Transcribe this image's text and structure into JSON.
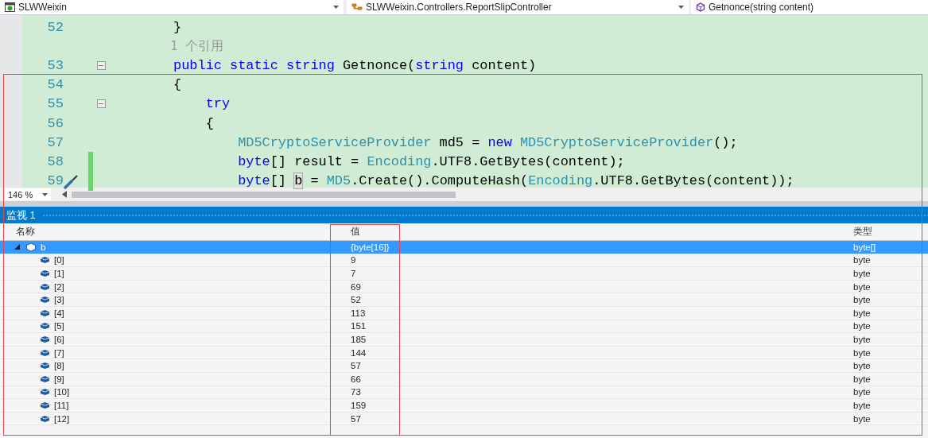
{
  "toolbar": {
    "project": "SLWWeixin",
    "class": "SLWWeixin.Controllers.ReportSlipController",
    "member": "Getnonce(string content)"
  },
  "editor": {
    "lines": [
      {
        "number": "52",
        "collapsible": false,
        "changed": false,
        "quick_action": false,
        "tokens": [
          {
            "text": "        }",
            "kind": "plain"
          }
        ]
      },
      {
        "collapsible": false,
        "changed": false,
        "quick_action": false,
        "tokens": [
          {
            "text": "        1 个引用",
            "kind": "hint"
          }
        ]
      },
      {
        "number": "53",
        "collapsible": true,
        "changed": false,
        "quick_action": false,
        "tokens": [
          {
            "text": "        public static string",
            "kind": "keyword"
          },
          {
            "text": " Getnonce(",
            "kind": "plain"
          },
          {
            "text": "string",
            "kind": "keyword"
          },
          {
            "text": " content)",
            "kind": "plain"
          }
        ]
      },
      {
        "number": "54",
        "collapsible": false,
        "changed": false,
        "quick_action": false,
        "tokens": [
          {
            "text": "        {",
            "kind": "plain"
          }
        ]
      },
      {
        "number": "55",
        "collapsible": true,
        "changed": false,
        "quick_action": false,
        "tokens": [
          {
            "text": "            try",
            "kind": "keyword"
          }
        ]
      },
      {
        "number": "56",
        "collapsible": false,
        "changed": false,
        "quick_action": false,
        "tokens": [
          {
            "text": "            {",
            "kind": "plain"
          }
        ]
      },
      {
        "number": "57",
        "collapsible": false,
        "changed": false,
        "quick_action": false,
        "tokens": [
          {
            "text": "                MD5CryptoServiceProvider",
            "kind": "type"
          },
          {
            "text": " md5 = ",
            "kind": "plain"
          },
          {
            "text": "new",
            "kind": "keyword"
          },
          {
            "text": " MD5CryptoServiceProvider",
            "kind": "type"
          },
          {
            "text": "();",
            "kind": "plain"
          }
        ]
      },
      {
        "number": "58",
        "collapsible": false,
        "changed": true,
        "quick_action": false,
        "tokens": [
          {
            "text": "                byte",
            "kind": "keyword"
          },
          {
            "text": "[] result = ",
            "kind": "plain"
          },
          {
            "text": "Encoding",
            "kind": "type"
          },
          {
            "text": ".UTF8.GetBytes(content);",
            "kind": "plain"
          }
        ]
      },
      {
        "number": "59",
        "collapsible": false,
        "changed": true,
        "quick_action": true,
        "tokens": [
          {
            "text": "                byte",
            "kind": "keyword"
          },
          {
            "text": "[] ",
            "kind": "plain"
          },
          {
            "text": "b",
            "kind": "highlight"
          },
          {
            "text": " = ",
            "kind": "plain"
          },
          {
            "text": "MD5",
            "kind": "type"
          },
          {
            "text": ".Create().ComputeHash(",
            "kind": "plain"
          },
          {
            "text": "Encoding",
            "kind": "type"
          },
          {
            "text": ".UTF8.GetBytes(content));",
            "kind": "plain"
          }
        ]
      }
    ]
  },
  "zoom": "146 %",
  "watch": {
    "title": "监视 1",
    "columns": [
      "名称",
      "值",
      "类型"
    ],
    "rows": [
      {
        "name": "b",
        "value": "{byte[16]}",
        "type": "byte[]",
        "selected": true,
        "expanded": true,
        "children": [
          {
            "name": "[0]",
            "value": "9",
            "type": "byte",
            "selected": false
          },
          {
            "name": "[1]",
            "value": "7",
            "type": "byte",
            "selected": false
          },
          {
            "name": "[2]",
            "value": "69",
            "type": "byte",
            "selected": false
          },
          {
            "name": "[3]",
            "value": "52",
            "type": "byte",
            "selected": false
          },
          {
            "name": "[4]",
            "value": "113",
            "type": "byte",
            "selected": false
          },
          {
            "name": "[5]",
            "value": "151",
            "type": "byte",
            "selected": false
          },
          {
            "name": "[6]",
            "value": "185",
            "type": "byte",
            "selected": false
          },
          {
            "name": "[7]",
            "value": "144",
            "type": "byte",
            "selected": false
          },
          {
            "name": "[8]",
            "value": "57",
            "type": "byte",
            "selected": false
          },
          {
            "name": "[9]",
            "value": "66",
            "type": "byte",
            "selected": false
          },
          {
            "name": "[10]",
            "value": "73",
            "type": "byte",
            "selected": false
          },
          {
            "name": "[11]",
            "value": "159",
            "type": "byte",
            "selected": false
          },
          {
            "name": "[12]",
            "value": "57",
            "type": "byte",
            "selected": false
          }
        ]
      }
    ]
  }
}
